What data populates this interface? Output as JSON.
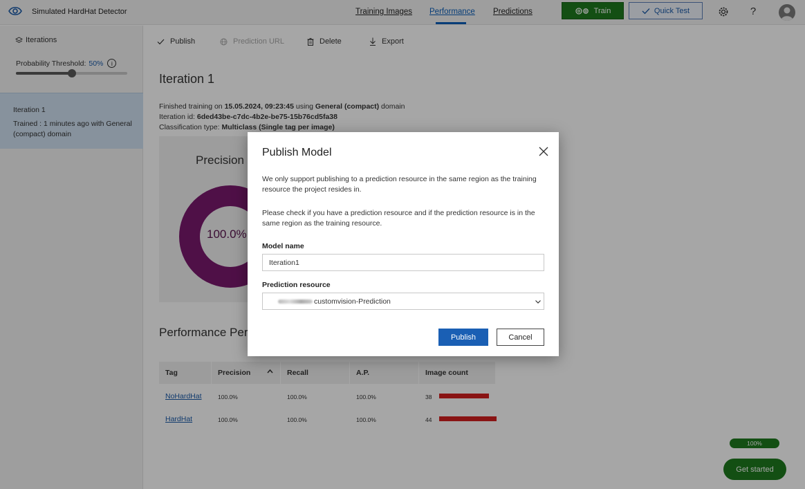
{
  "header": {
    "app_title": "Simulated HardHat Detector",
    "nav": [
      {
        "label": "Training Images"
      },
      {
        "label": "Performance"
      },
      {
        "label": "Predictions"
      }
    ],
    "train_label": "Train",
    "quick_test_label": "Quick Test",
    "help_label": "?",
    "icons": {
      "app": "eye-icon",
      "train": "gears-icon",
      "quick_test": "checkmark-icon",
      "settings": "gear-icon",
      "avatar": "user-avatar-icon"
    }
  },
  "sidebar": {
    "header": "Iterations",
    "threshold_label": "Probability Threshold:",
    "threshold_value": "50%",
    "threshold_fraction": 0.5,
    "iteration": {
      "name": "Iteration 1",
      "desc": "Trained : 1 minutes ago with General (compact) domain"
    }
  },
  "toolbar": {
    "publish": "Publish",
    "prediction_url": "Prediction URL",
    "delete": "Delete",
    "export": "Export"
  },
  "main": {
    "title": "Iteration 1",
    "line1": {
      "prefix": "Finished training on ",
      "date": "15.05.2024, 09:23:45",
      "mid": " using ",
      "domain": "General (compact)",
      "suffix": " domain"
    },
    "line2": {
      "prefix": "Iteration id: ",
      "id": "6ded43be-c7dc-4b2e-be75-15b76cd5fa38"
    },
    "line3": {
      "prefix": "Classification type: ",
      "type": "Multiclass (Single tag per image)"
    },
    "precision_title": "Precision",
    "precision_value": "100.0%",
    "section_title": "Performance Per Tag",
    "table": {
      "headers": [
        "Tag",
        "Precision",
        "Recall",
        "A.P.",
        "Image count"
      ],
      "rows": [
        {
          "tag": "NoHardHat",
          "precision": "100.0%",
          "recall": "100.0%",
          "ap": "100.0%",
          "count": "38",
          "count_num": 38
        },
        {
          "tag": "HardHat",
          "precision": "100.0%",
          "recall": "100.0%",
          "ap": "100.0%",
          "count": "44",
          "count_num": 44
        }
      ]
    }
  },
  "progress_label": "100%",
  "get_started_label": "Get started",
  "modal": {
    "title": "Publish Model",
    "p1": "We only support publishing to a prediction resource in the same region as the training resource the project resides in.",
    "p2": "Please check if you have a prediction resource and if the prediction resource is in the same region as the training resource.",
    "model_name_label": "Model name",
    "model_name_value": "Iteration1",
    "prediction_resource_label": "Prediction resource",
    "prediction_resource_value": "customvision-Prediction",
    "publish_label": "Publish",
    "cancel_label": "Cancel"
  },
  "colors": {
    "accent": "#1a5fb4",
    "train_green": "#1e7a1e",
    "bar_red": "#d31f1f",
    "donut": "#7a1a6e"
  }
}
